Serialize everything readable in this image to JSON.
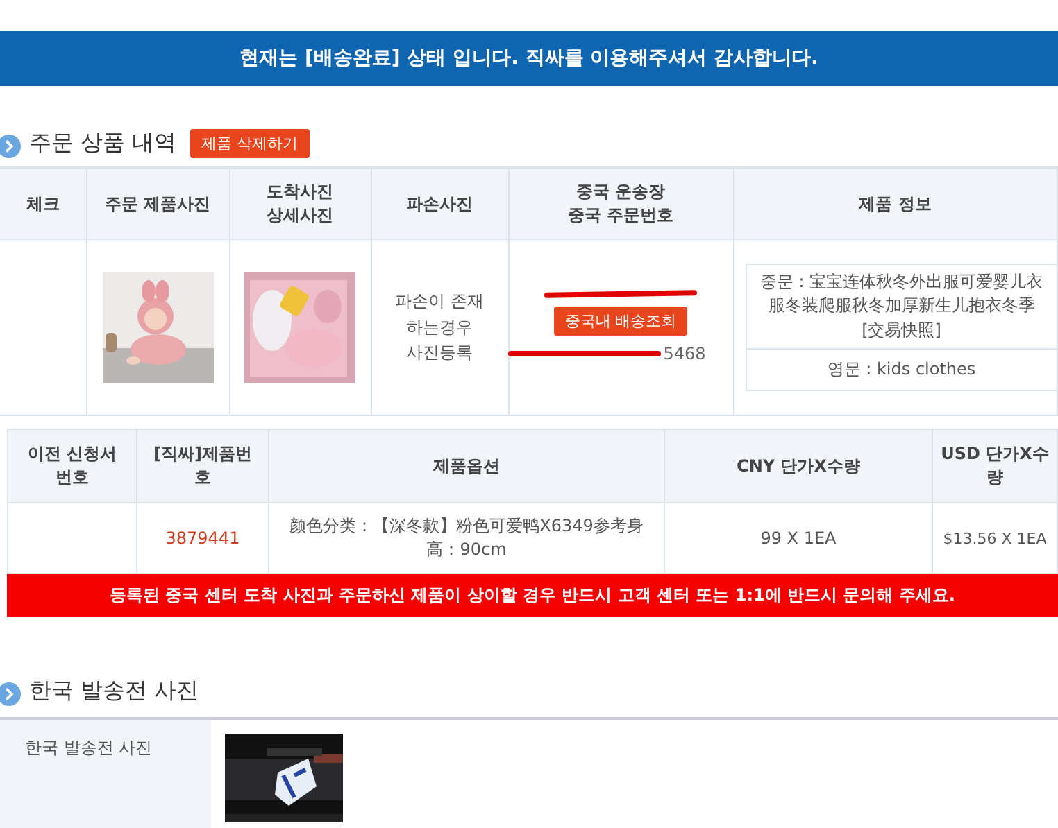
{
  "banner": "현재는 [배송완료] 상태 입니다. 직싸를 이용해주셔서 감사합니다.",
  "order_section": {
    "title": "주문 상품 내역",
    "delete_button": "제품 삭제하기",
    "columns": [
      "체크",
      "주문 제품사진",
      "도착사진\n상세사진",
      "파손사진",
      "중국 운송장\n중국 주문번호",
      "제품 정보"
    ],
    "row": {
      "damage_note": "파손이 존재\n하는경우\n사진등록",
      "tracking_number_redacted": true,
      "track_button": "중국내 배송조회",
      "order_number": "5468",
      "chinese_name": "중문 : 宝宝连体秋冬外出服可爱婴儿衣服冬装爬服秋冬加厚新生儿抱衣冬季 [交易快照]",
      "english_name": "영문 : kids clothes"
    }
  },
  "detail_table": {
    "columns": [
      "이전 신청서\n번호",
      "[직싸]제품번\n호",
      "제품옵션",
      "CNY 단가X수량",
      "USD 단가X수\n량"
    ],
    "row": {
      "product_number": "3879441",
      "option": "颜色分类：【深冬款】粉色可爱鸭X6349参考身高：90cm",
      "cny": "99 X 1EA",
      "usd": "$13.56 X 1EA"
    },
    "notice": "등록된 중국 센터 도착 사진과 주문하신 제품이 상이할 경우 반드시 고객 센터 또는 1:1에 반드시 문의해 주세요."
  },
  "korea_section": {
    "title": "한국 발송전 사진",
    "label": "한국 발송전 사진"
  }
}
